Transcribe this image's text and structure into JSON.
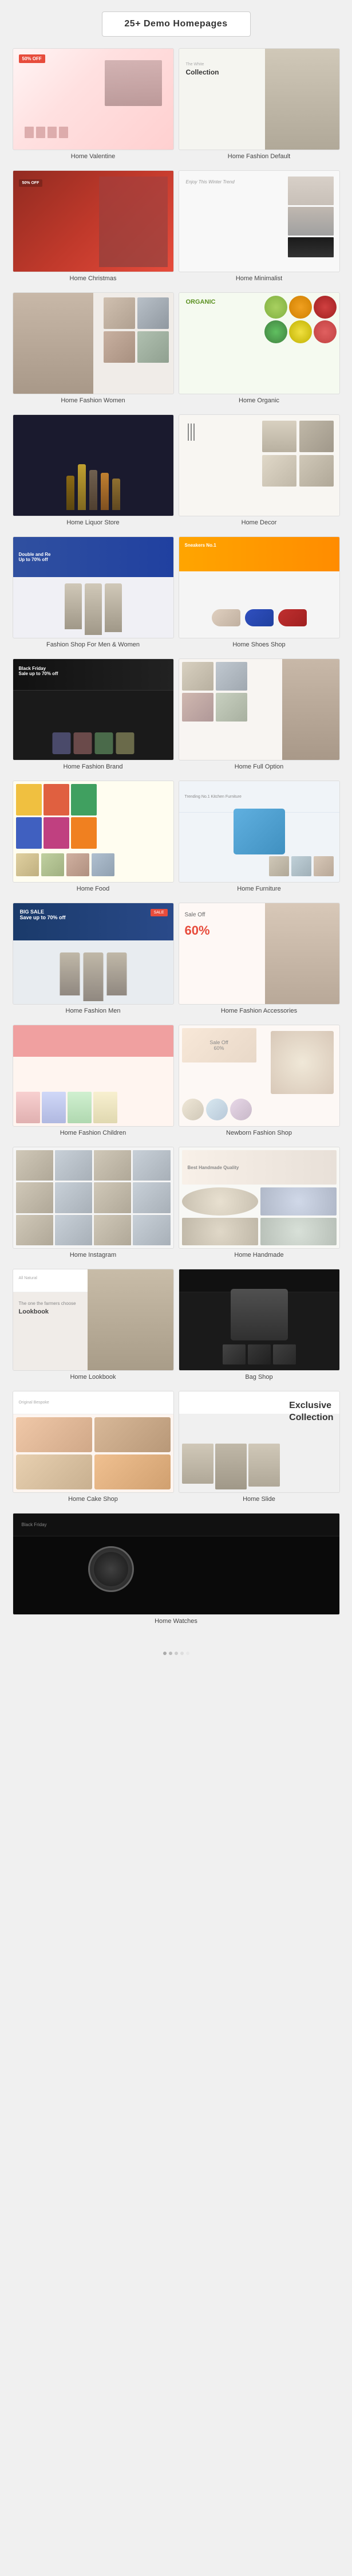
{
  "page": {
    "title": "25+ Demo Homepages",
    "demos": [
      {
        "id": "valentine",
        "label": "Home Valentine",
        "style": "thumb-valentine"
      },
      {
        "id": "fashion-default",
        "label": "Home Fashion Default",
        "style": "thumb-fashion-default"
      },
      {
        "id": "christmas",
        "label": "Home Christmas",
        "style": "thumb-christmas"
      },
      {
        "id": "minimalist",
        "label": "Home Minimalist",
        "style": "thumb-minimalist"
      },
      {
        "id": "fashion-women",
        "label": "Home Fashion Women",
        "style": "thumb-fashion-women"
      },
      {
        "id": "organic",
        "label": "Home Organic",
        "style": "thumb-organic"
      },
      {
        "id": "liquor",
        "label": "Home Liquor Store",
        "style": "thumb-liquor"
      },
      {
        "id": "decor",
        "label": "Home Decor",
        "style": "thumb-decor"
      },
      {
        "id": "fashion-men-women",
        "label": "Fashion Shop For Men & Women",
        "style": "thumb-fashion-men-women"
      },
      {
        "id": "shoes",
        "label": "Home Shoes Shop",
        "style": "thumb-shoes"
      },
      {
        "id": "brand",
        "label": "Home Fashion Brand",
        "style": "thumb-brand"
      },
      {
        "id": "full-option",
        "label": "Home Full Option",
        "style": "thumb-full-option"
      },
      {
        "id": "food",
        "label": "Home Food",
        "style": "thumb-food"
      },
      {
        "id": "furniture",
        "label": "Home Furniture",
        "style": "thumb-furniture"
      },
      {
        "id": "fashion-men",
        "label": "Home Fashion Men",
        "style": "thumb-fashion-men"
      },
      {
        "id": "fashion-acc",
        "label": "Home Fashion Accessories",
        "style": "thumb-fashion-acc"
      },
      {
        "id": "fashion-children",
        "label": "Home Fashion Children",
        "style": "thumb-fashion-children"
      },
      {
        "id": "newborn",
        "label": "Newborn Fashion Shop",
        "style": "thumb-newborn"
      },
      {
        "id": "instagram",
        "label": "Home Instagram",
        "style": "thumb-instagram"
      },
      {
        "id": "handmade",
        "label": "Home Handmade",
        "style": "thumb-handmade"
      },
      {
        "id": "lookbook",
        "label": "Home Lookbook",
        "style": "thumb-lookbook"
      },
      {
        "id": "bag",
        "label": "Bag Shop",
        "style": "thumb-bag"
      },
      {
        "id": "cake",
        "label": "Home Cake Shop",
        "style": "thumb-cake"
      },
      {
        "id": "slide",
        "label": "Home Slide",
        "style": "thumb-slide"
      },
      {
        "id": "watches",
        "label": "Home Watches",
        "style": "thumb-watches"
      }
    ]
  }
}
